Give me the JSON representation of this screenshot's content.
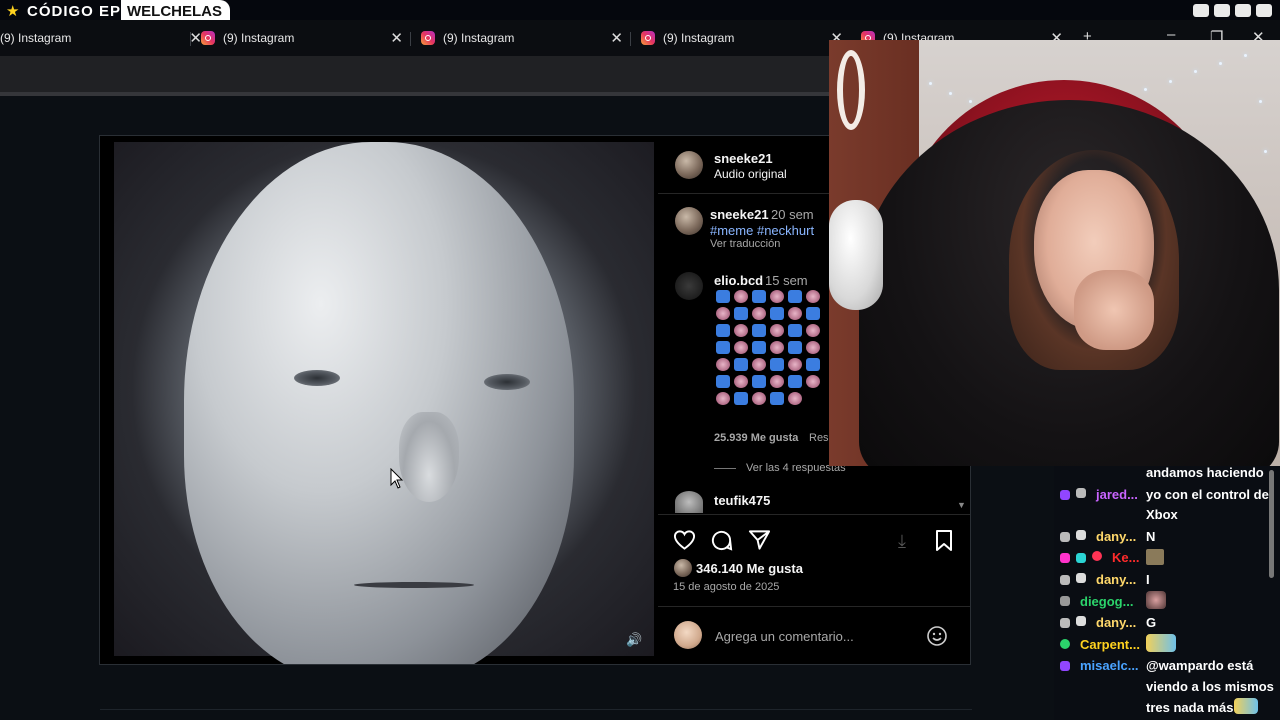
{
  "banner": {
    "title": "CÓDIGO EPIC",
    "tag": "WELCHELAS"
  },
  "tabs": [
    {
      "label": "(9) Instagram"
    },
    {
      "label": "(9) Instagram"
    },
    {
      "label": "(9) Instagram"
    },
    {
      "label": "(9) Instagram"
    },
    {
      "label": "(9) Instagram"
    }
  ],
  "post": {
    "author": "sneeke21",
    "audio": "Audio original",
    "caption_author": "sneeke21",
    "caption_time": "20 sem",
    "hashtags": "#meme #neckhurt",
    "translate": "Ver traducción",
    "comment": {
      "author": "elio.bcd",
      "time": "15 sem",
      "likes": "25.939 Me gusta",
      "reply": "Resp",
      "view_replies": "Ver las 4 respuestas"
    },
    "next_comment_author": "teufik475",
    "likes": "346.140 Me gusta",
    "date": "15 de agosto de 2025",
    "add_comment_placeholder": "Agrega un comentario..."
  },
  "chat": {
    "lines": [
      {
        "user": "",
        "message": "andamos haciendo",
        "color": "#ffffff"
      },
      {
        "user": "jared...",
        "message": "yo con el control de",
        "color": "#c964ff"
      },
      {
        "user": "",
        "message": "Xbox",
        "color": "#ffffff"
      },
      {
        "user": "dany...",
        "message": "N",
        "color": "#ffd86b"
      },
      {
        "user": "Ke...",
        "message": "",
        "color": "#ff2b2b"
      },
      {
        "user": "dany...",
        "message": "I",
        "color": "#ffd86b"
      },
      {
        "user": "diegog...",
        "message": "",
        "color": "#2bd46b"
      },
      {
        "user": "dany...",
        "message": "G",
        "color": "#ffd86b"
      },
      {
        "user": "Carpent...",
        "message": "",
        "color": "#ffd21f"
      },
      {
        "user": "misaelc...",
        "message": "@wampardo está",
        "color": "#4aa3ff"
      },
      {
        "user": "",
        "message": "viendo a los mismos",
        "color": "#ffffff"
      },
      {
        "user": "",
        "message": "tres nada más",
        "color": "#ffffff"
      }
    ]
  }
}
